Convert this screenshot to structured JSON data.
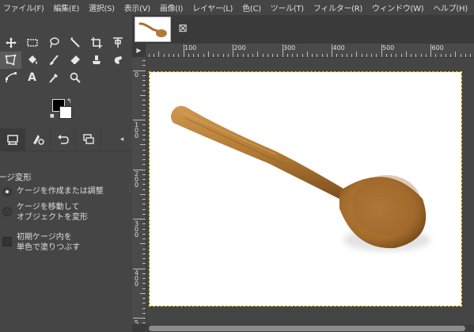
{
  "menu": [
    "ファイル(F)",
    "編集(E)",
    "選択(S)",
    "表示(V)",
    "画像(I)",
    "レイヤー(L)",
    "色(C)",
    "ツール(T)",
    "フィルター(R)",
    "ウィンドウ(W)",
    "ヘルプ(H)"
  ],
  "toolbox": {
    "tools": [
      {
        "name": "move-tool-icon",
        "glyph": "✥"
      },
      {
        "name": "rect-select-tool-icon",
        "glyph": "▭"
      },
      {
        "name": "lasso-tool-icon",
        "glyph": "ⵔ"
      },
      {
        "name": "fuzzy-select-tool-icon",
        "glyph": "⟋"
      },
      {
        "name": "crop-tool-icon",
        "glyph": "⌗"
      },
      {
        "name": "text-align-tool-icon",
        "glyph": "⊤"
      },
      {
        "name": "perspective-tool-icon",
        "glyph": "◇"
      },
      {
        "name": "bucket-fill-tool-icon",
        "glyph": "◆"
      },
      {
        "name": "paintbrush-tool-icon",
        "glyph": "⟋"
      },
      {
        "name": "eraser-tool-icon",
        "glyph": "◈"
      },
      {
        "name": "clone-tool-icon",
        "glyph": "♣"
      },
      {
        "name": "smudge-tool-icon",
        "glyph": "✋"
      },
      {
        "name": "paths-tool-icon",
        "glyph": "⤢"
      },
      {
        "name": "text-tool-icon",
        "glyph": "A"
      },
      {
        "name": "color-picker-tool-icon",
        "glyph": "⟋"
      },
      {
        "name": "zoom-tool-icon",
        "glyph": "⌕"
      }
    ],
    "active_tool_index": 6
  },
  "dock": {
    "tabs": [
      "tool-options-tab",
      "device-status-tab",
      "undo-history-tab",
      "images-tab"
    ],
    "active_tab_index": 0
  },
  "tool_options": {
    "title": "ージ変形",
    "option_create_adjust": "ケージを作成または調整",
    "option_move_transform_line1": "ケージを移動して",
    "option_move_transform_line2": "オブジェクトを変形",
    "option_fill_line1": "初期ケージ内を",
    "option_fill_line2": "単色で塗りつぶす",
    "selected_option": "create-adjust",
    "fill_checked": false
  },
  "ruler": {
    "h_labels": [
      "100",
      "200",
      "300",
      "400",
      "500",
      "600"
    ],
    "v_labels": [
      "0",
      "1 0 0",
      "2 0 0",
      "3 0 0",
      "4 0 0",
      "5"
    ]
  },
  "colors": {
    "foreground": "#000000",
    "background": "#ffffff",
    "selection_border": "#e8d000",
    "spoon_wood": "#b27a34"
  }
}
